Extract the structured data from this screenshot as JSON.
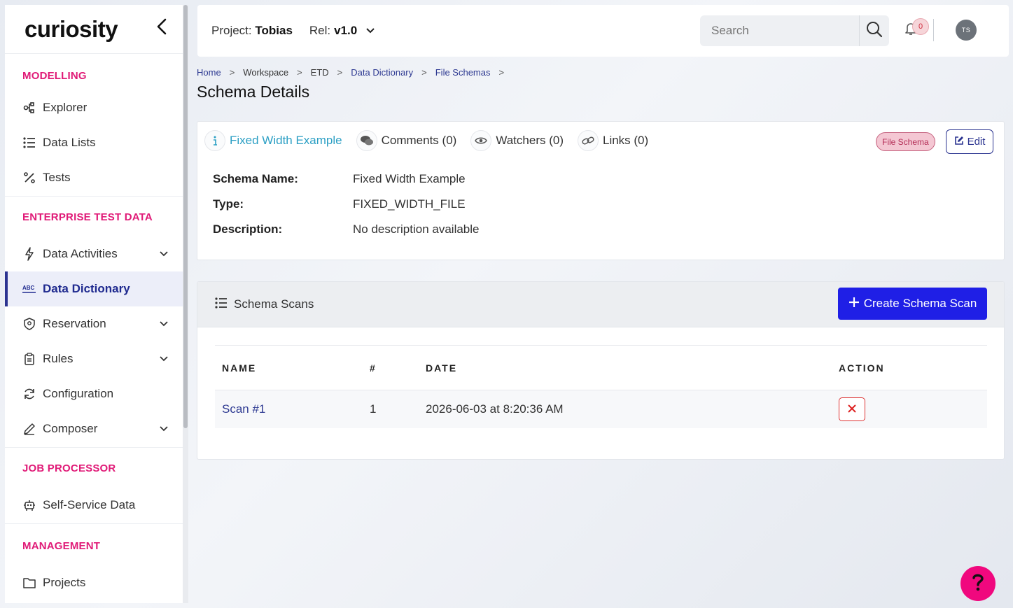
{
  "brand": {
    "logo_text": "curiosity"
  },
  "sidebar": {
    "sections": [
      {
        "label": "MODELLING"
      },
      {
        "label": "ENTERPRISE TEST DATA"
      },
      {
        "label": "JOB PROCESSOR"
      },
      {
        "label": "MANAGEMENT"
      }
    ],
    "items": [
      {
        "label": "Explorer",
        "icon": "graph-icon"
      },
      {
        "label": "Data Lists",
        "icon": "list-icon"
      },
      {
        "label": "Tests",
        "icon": "percent-icon"
      },
      {
        "label": "Data Activities",
        "icon": "bolt-icon"
      },
      {
        "label": "Data Dictionary",
        "icon": "abc-icon"
      },
      {
        "label": "Reservation",
        "icon": "shield-icon"
      },
      {
        "label": "Rules",
        "icon": "clipboard-icon"
      },
      {
        "label": "Configuration",
        "icon": "sync-icon"
      },
      {
        "label": "Composer",
        "icon": "pencil-icon"
      },
      {
        "label": "Self-Service Data",
        "icon": "robot-icon"
      },
      {
        "label": "Projects",
        "icon": "folder-icon"
      }
    ]
  },
  "header": {
    "project_label": "Project:",
    "project_name": "Tobias",
    "release_label": "Rel:",
    "release_value": "v1.0",
    "search_placeholder": "Search",
    "notification_count": "0",
    "avatar_initials": "TS"
  },
  "breadcrumb": [
    "Home",
    "Workspace",
    "ETD",
    "Data Dictionary",
    "File Schemas"
  ],
  "page_title": "Schema Details",
  "details": {
    "tabs": [
      {
        "label": "Fixed Width Example",
        "icon": "info-icon"
      },
      {
        "label": "Comments (0)",
        "icon": "comments-icon"
      },
      {
        "label": "Watchers (0)",
        "icon": "eye-icon"
      },
      {
        "label": "Links (0)",
        "icon": "link-icon"
      }
    ],
    "tag": "File Schema",
    "edit_label": "Edit",
    "fields": [
      {
        "key": "Schema Name:",
        "value": "Fixed Width Example"
      },
      {
        "key": "Type:",
        "value": "FIXED_WIDTH_FILE"
      },
      {
        "key": "Description:",
        "value": "No description available"
      }
    ]
  },
  "scans": {
    "title": "Schema Scans",
    "create_label": "Create Schema Scan",
    "columns": [
      "NAME",
      "#",
      "DATE",
      "ACTION"
    ],
    "rows": [
      {
        "name": "Scan #1",
        "num": "1",
        "date": "2026-06-03 at 8:20:36 AM"
      }
    ]
  },
  "colors": {
    "accent": "#1f1fe6",
    "brand_pink": "#e01a77",
    "nav_active": "#1f2a8f"
  }
}
